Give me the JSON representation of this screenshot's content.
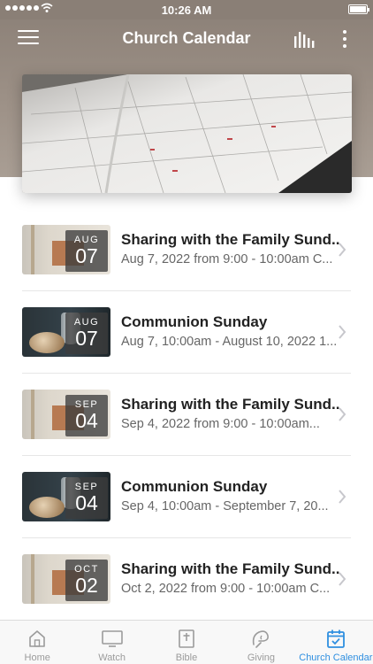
{
  "status_bar": {
    "time": "10:26 AM"
  },
  "header": {
    "title": "Church Calendar",
    "menu_icon": "hamburger-menu-icon",
    "chart_icon": "bar-chart-icon",
    "more_icon": "more-vertical-icon"
  },
  "hero": {
    "icon": "calendar-planner-photo"
  },
  "events": [
    {
      "month": "AUG",
      "day": "07",
      "title": "Sharing with the Family Sund...",
      "subtitle": "Aug 7, 2022 from 9:00 - 10:00am C...",
      "thumb": "family"
    },
    {
      "month": "AUG",
      "day": "07",
      "title": "Communion Sunday",
      "subtitle": "Aug 7, 10:00am - August 10, 2022 1...",
      "thumb": "communion"
    },
    {
      "month": "SEP",
      "day": "04",
      "title": "Sharing with the Family Sund...",
      "subtitle": "Sep 4, 2022 from 9:00 - 10:00am...",
      "thumb": "family"
    },
    {
      "month": "SEP",
      "day": "04",
      "title": "Communion Sunday",
      "subtitle": "Sep 4, 10:00am - September 7, 20...",
      "thumb": "communion"
    },
    {
      "month": "OCT",
      "day": "02",
      "title": "Sharing with the Family Sund...",
      "subtitle": "Oct 2, 2022 from 9:00 - 10:00am C...",
      "thumb": "family"
    }
  ],
  "tabs": [
    {
      "label": "Home",
      "icon": "home-icon"
    },
    {
      "label": "Watch",
      "icon": "tv-icon"
    },
    {
      "label": "Bible",
      "icon": "bible-icon"
    },
    {
      "label": "Giving",
      "icon": "giving-icon"
    },
    {
      "label": "Church Calendar",
      "icon": "calendar-icon",
      "active": true
    }
  ],
  "colors": {
    "header": "#8a7f76",
    "active_tab": "#2f8fe0",
    "inactive_tab": "#9b9b9b"
  }
}
